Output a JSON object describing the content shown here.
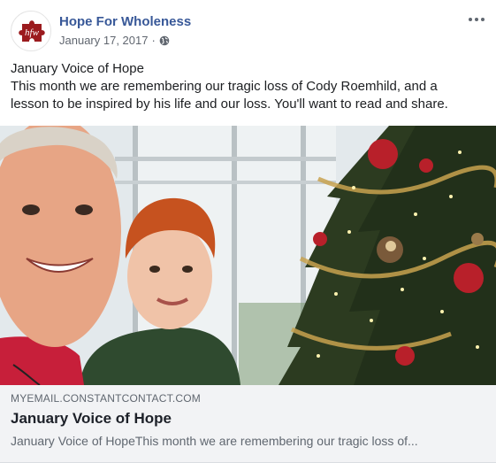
{
  "header": {
    "page_name": "Hope For Wholeness",
    "avatar_text": "hfw",
    "date": "January 17, 2017",
    "separator": "·",
    "privacy_icon": "globe-icon",
    "more_icon": "more-options-icon"
  },
  "post": {
    "title_line": "January Voice of Hope",
    "body_line_1": "This month we are remembering our tragic loss of Cody Roemhild, and a",
    "body_line_2": "lesson to be inspired by his life and our loss. You'll want to read and share."
  },
  "link_preview": {
    "domain": "MYEMAIL.CONSTANTCONTACT.COM",
    "title": "January Voice of Hope",
    "description": "January Voice of HopeThis month we are remembering our tragic loss of..."
  },
  "colors": {
    "page_name": "#385898",
    "logo_red": "#9b1b1e",
    "link_bg": "#f2f3f5"
  }
}
